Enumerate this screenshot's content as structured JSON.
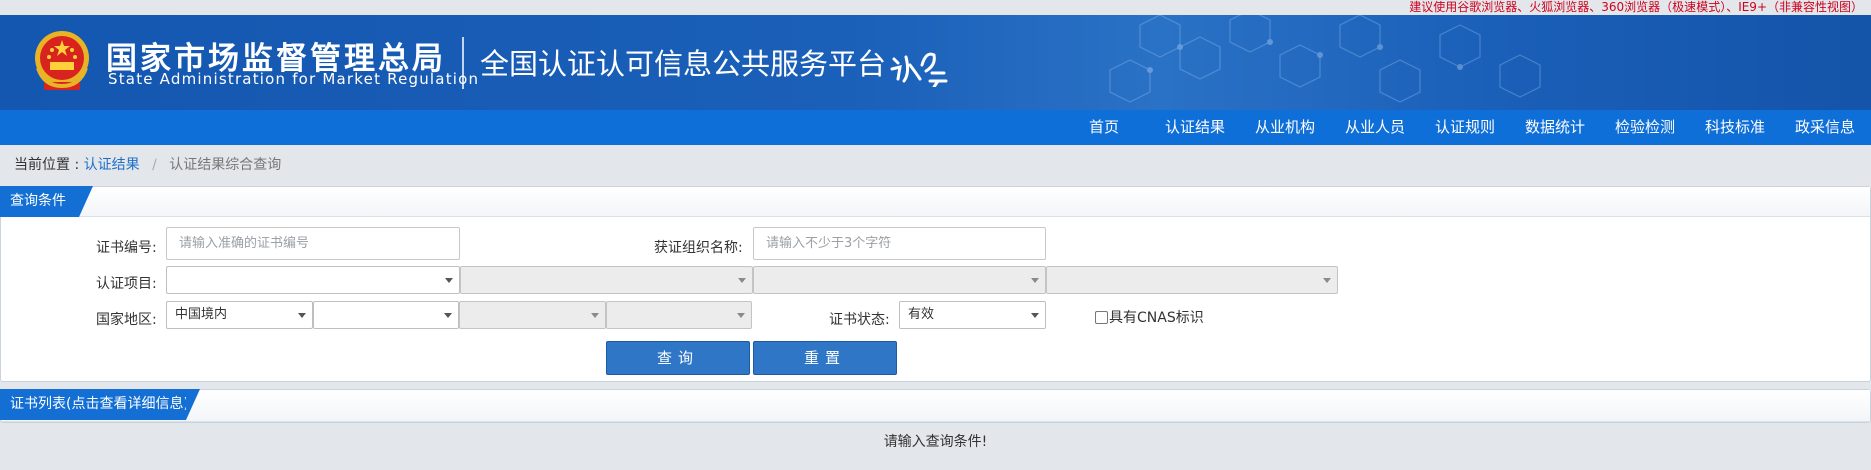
{
  "browser_tip": "建议使用谷歌浏览器、火狐浏览器、360浏览器（极速模式）、IE9+（非兼容性视图）",
  "header": {
    "org_name_cn": "国家市场监督管理总局",
    "org_name_en": "State Administration  for  Market Regulation",
    "platform_title": "全国认证认可信息公共服务平台",
    "brand_color": "#1a5fb8"
  },
  "nav": {
    "items": [
      "首页",
      "认证结果",
      "从业机构",
      "从业人员",
      "认证规则",
      "数据统计",
      "检验检测",
      "科技标准",
      "政采信息"
    ],
    "bar_color": "#0f6fd8"
  },
  "breadcrumb": {
    "label": "当前位置 :",
    "link": "认证结果",
    "separator": "/",
    "current": "认证结果综合查询"
  },
  "query_panel": {
    "title": "查询条件",
    "cert_no_label": "证书编号:",
    "cert_no_placeholder": "请输入准确的证书编号",
    "org_name_label": "获证组织名称:",
    "org_name_placeholder": "请输入不少于3个字符",
    "project_label": "认证项目:",
    "project_selects": [
      "",
      "",
      "",
      ""
    ],
    "region_label": "国家地区:",
    "region_selects": [
      "中国境内",
      "",
      "",
      ""
    ],
    "status_label": "证书状态:",
    "status_value": "有效",
    "cnas_label": "具有CNAS标识",
    "cnas_checked": false,
    "search_button": "查询",
    "reset_button": "重置"
  },
  "result_panel": {
    "title": "证书列表(点击查看详细信息)",
    "empty_message": "请输入查询条件!"
  }
}
